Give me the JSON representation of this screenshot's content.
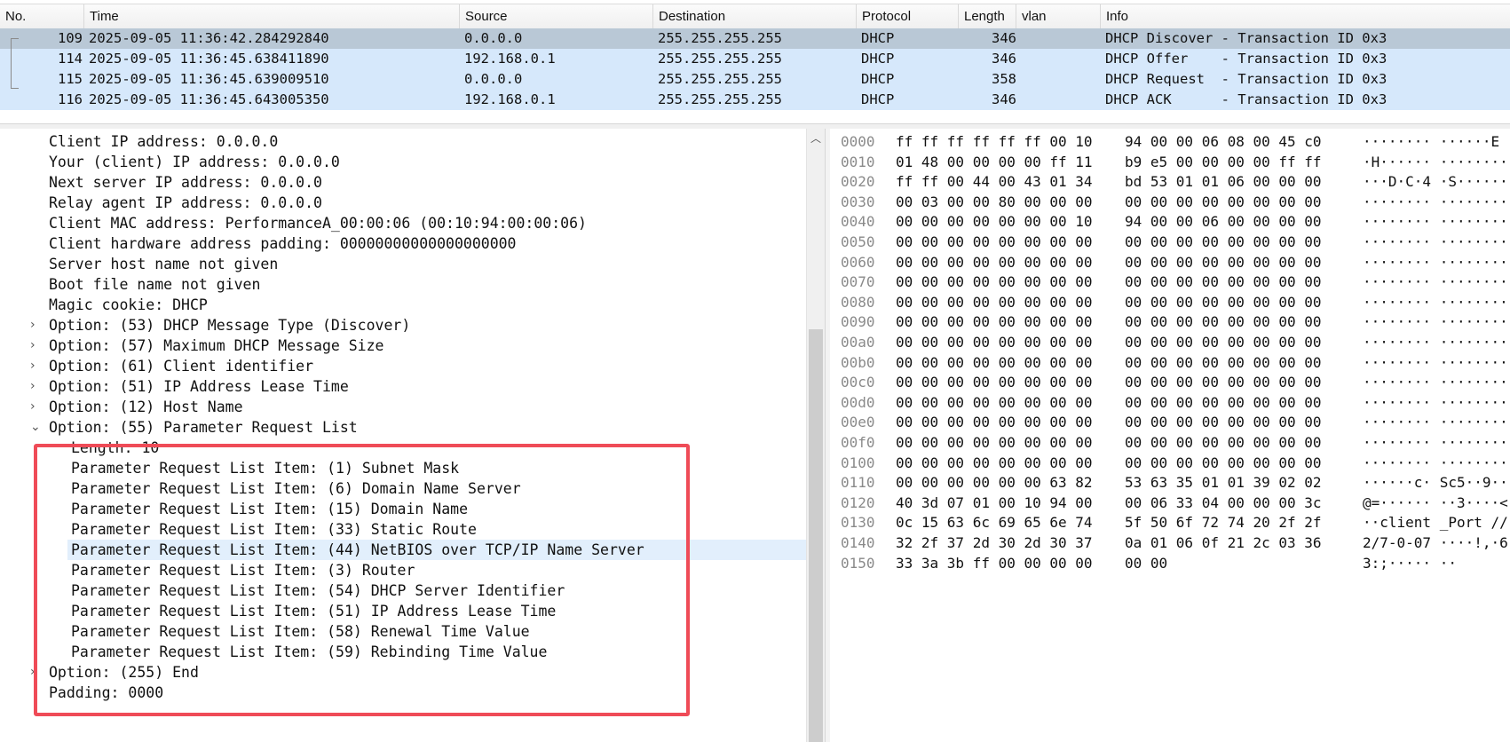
{
  "packet_list": {
    "columns": [
      "No.",
      "Time",
      "Source",
      "Destination",
      "Protocol",
      "Length",
      "vlan",
      "Info"
    ],
    "rows": [
      {
        "no": "109",
        "time": "2025-09-05 11:36:42.284292840",
        "source": "0.0.0.0",
        "destination": "255.255.255.255",
        "protocol": "DHCP",
        "length": "346",
        "vlan": "",
        "info": "DHCP Discover - Transaction ID 0x3"
      },
      {
        "no": "114",
        "time": "2025-09-05 11:36:45.638411890",
        "source": "192.168.0.1",
        "destination": "255.255.255.255",
        "protocol": "DHCP",
        "length": "346",
        "vlan": "",
        "info": "DHCP Offer    - Transaction ID 0x3"
      },
      {
        "no": "115",
        "time": "2025-09-05 11:36:45.639009510",
        "source": "0.0.0.0",
        "destination": "255.255.255.255",
        "protocol": "DHCP",
        "length": "358",
        "vlan": "",
        "info": "DHCP Request  - Transaction ID 0x3"
      },
      {
        "no": "116",
        "time": "2025-09-05 11:36:45.643005350",
        "source": "192.168.0.1",
        "destination": "255.255.255.255",
        "protocol": "DHCP",
        "length": "346",
        "vlan": "",
        "info": "DHCP ACK      - Transaction ID 0x3"
      }
    ]
  },
  "details": {
    "lines": [
      {
        "text": "Client IP address: 0.0.0.0"
      },
      {
        "text": "Your (client) IP address: 0.0.0.0"
      },
      {
        "text": "Next server IP address: 0.0.0.0"
      },
      {
        "text": "Relay agent IP address: 0.0.0.0"
      },
      {
        "text": "Client MAC address: PerformanceA_00:00:06 (00:10:94:00:00:06)"
      },
      {
        "text": "Client hardware address padding: 00000000000000000000"
      },
      {
        "text": "Server host name not given"
      },
      {
        "text": "Boot file name not given"
      },
      {
        "text": "Magic cookie: DHCP"
      },
      {
        "text": "Option: (53) DHCP Message Type (Discover)",
        "expander": "›"
      },
      {
        "text": "Option: (57) Maximum DHCP Message Size",
        "expander": "›"
      },
      {
        "text": "Option: (61) Client identifier",
        "expander": "›"
      },
      {
        "text": "Option: (51) IP Address Lease Time",
        "expander": "›"
      },
      {
        "text": "Option: (12) Host Name",
        "expander": "›"
      },
      {
        "text": "Option: (55) Parameter Request List",
        "expander": "⌄"
      },
      {
        "text": "Length: 10"
      },
      {
        "text": "Parameter Request List Item: (1) Subnet Mask"
      },
      {
        "text": "Parameter Request List Item: (6) Domain Name Server"
      },
      {
        "text": "Parameter Request List Item: (15) Domain Name"
      },
      {
        "text": "Parameter Request List Item: (33) Static Route"
      },
      {
        "text": "Parameter Request List Item: (44) NetBIOS over TCP/IP Name Server"
      },
      {
        "text": "Parameter Request List Item: (3) Router"
      },
      {
        "text": "Parameter Request List Item: (54) DHCP Server Identifier"
      },
      {
        "text": "Parameter Request List Item: (51) IP Address Lease Time"
      },
      {
        "text": "Parameter Request List Item: (58) Renewal Time Value"
      },
      {
        "text": "Parameter Request List Item: (59) Rebinding Time Value"
      },
      {
        "text": "Option: (255) End",
        "expander": "›"
      },
      {
        "text": "Padding: 0000"
      }
    ]
  },
  "hex": {
    "lines": [
      {
        "offset": "0000",
        "bytes1": "ff ff ff ff ff ff 00 10",
        "bytes2": "94 00 00 06 08 00 45 c0",
        "ascii": "········ ······E"
      },
      {
        "offset": "0010",
        "bytes1": "01 48 00 00 00 00 ff 11",
        "bytes2": "b9 e5 00 00 00 00 ff ff",
        "ascii": "·H······ ········"
      },
      {
        "offset": "0020",
        "bytes1": "ff ff 00 44 00 43 01 34",
        "bytes2": "bd 53 01 01 06 00 00 00",
        "ascii": "···D·C·4 ·S······"
      },
      {
        "offset": "0030",
        "bytes1": "00 03 00 00 80 00 00 00",
        "bytes2": "00 00 00 00 00 00 00 00",
        "ascii": "········ ········"
      },
      {
        "offset": "0040",
        "bytes1": "00 00 00 00 00 00 00 10",
        "bytes2": "94 00 00 06 00 00 00 00",
        "ascii": "········ ········"
      },
      {
        "offset": "0050",
        "bytes1": "00 00 00 00 00 00 00 00",
        "bytes2": "00 00 00 00 00 00 00 00",
        "ascii": "········ ········"
      },
      {
        "offset": "0060",
        "bytes1": "00 00 00 00 00 00 00 00",
        "bytes2": "00 00 00 00 00 00 00 00",
        "ascii": "········ ········"
      },
      {
        "offset": "0070",
        "bytes1": "00 00 00 00 00 00 00 00",
        "bytes2": "00 00 00 00 00 00 00 00",
        "ascii": "········ ········"
      },
      {
        "offset": "0080",
        "bytes1": "00 00 00 00 00 00 00 00",
        "bytes2": "00 00 00 00 00 00 00 00",
        "ascii": "········ ········"
      },
      {
        "offset": "0090",
        "bytes1": "00 00 00 00 00 00 00 00",
        "bytes2": "00 00 00 00 00 00 00 00",
        "ascii": "········ ········"
      },
      {
        "offset": "00a0",
        "bytes1": "00 00 00 00 00 00 00 00",
        "bytes2": "00 00 00 00 00 00 00 00",
        "ascii": "········ ········"
      },
      {
        "offset": "00b0",
        "bytes1": "00 00 00 00 00 00 00 00",
        "bytes2": "00 00 00 00 00 00 00 00",
        "ascii": "········ ········"
      },
      {
        "offset": "00c0",
        "bytes1": "00 00 00 00 00 00 00 00",
        "bytes2": "00 00 00 00 00 00 00 00",
        "ascii": "········ ········"
      },
      {
        "offset": "00d0",
        "bytes1": "00 00 00 00 00 00 00 00",
        "bytes2": "00 00 00 00 00 00 00 00",
        "ascii": "········ ········"
      },
      {
        "offset": "00e0",
        "bytes1": "00 00 00 00 00 00 00 00",
        "bytes2": "00 00 00 00 00 00 00 00",
        "ascii": "········ ········"
      },
      {
        "offset": "00f0",
        "bytes1": "00 00 00 00 00 00 00 00",
        "bytes2": "00 00 00 00 00 00 00 00",
        "ascii": "········ ········"
      },
      {
        "offset": "0100",
        "bytes1": "00 00 00 00 00 00 00 00",
        "bytes2": "00 00 00 00 00 00 00 00",
        "ascii": "········ ········"
      },
      {
        "offset": "0110",
        "bytes1": "00 00 00 00 00 00 63 82",
        "bytes2": "53 63 35 01 01 39 02 02",
        "ascii": "······c· Sc5··9··"
      },
      {
        "offset": "0120",
        "bytes1": "40 3d 07 01 00 10 94 00",
        "bytes2": "00 06 33 04 00 00 00 3c",
        "ascii": "@=······ ··3····<"
      },
      {
        "offset": "0130",
        "bytes1": "0c 15 63 6c 69 65 6e 74",
        "bytes2": "5f 50 6f 72 74 20 2f 2f",
        "ascii": "··client _Port //"
      },
      {
        "offset": "0140",
        "bytes1": "32 2f 37 2d 30 2d 30 37",
        "bytes2": "0a 01 06 0f 21 2c 03 36",
        "ascii": "2/7-0-07 ····!,·6"
      },
      {
        "offset": "0150",
        "bytes1": "33 3a 3b ff 00 00 00 00",
        "bytes2": "00 00",
        "ascii": "3:;····· ··"
      }
    ]
  },
  "colors": {
    "row_bg": "#d6e8fb",
    "row_selected_bg": "#b9c8d6",
    "tree_highlight_bg": "#e2effc",
    "annotation_box": "#ef4b57",
    "offset_text": "#8a8a8a"
  },
  "icons": {
    "collapsed": "chevron-right-icon",
    "expanded": "chevron-down-icon",
    "scroll_up": "chevron-up-icon"
  }
}
